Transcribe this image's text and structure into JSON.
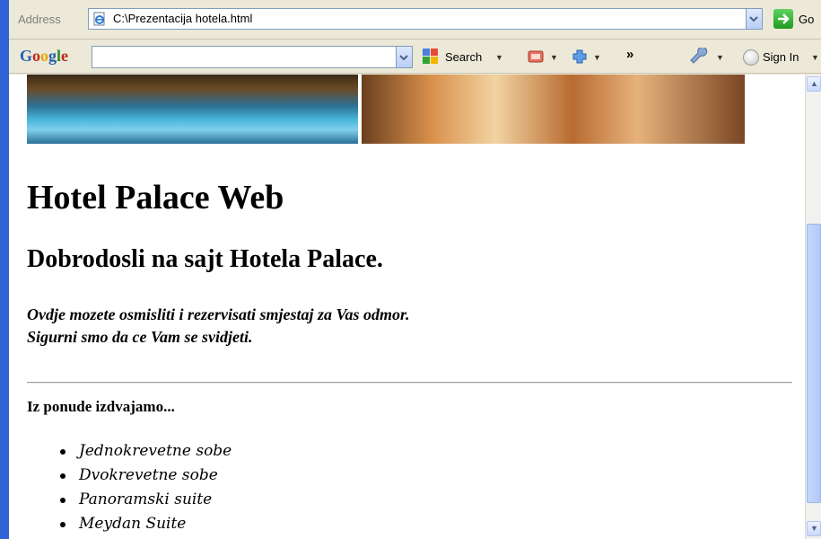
{
  "browser": {
    "address_label": "Address",
    "address_value": "C:\\Prezentacija hotela.html",
    "go_label": "Go"
  },
  "google_toolbar": {
    "logo": "Google",
    "search_query": "",
    "search_label": "Search",
    "more_label": "»",
    "sign_in_label": "Sign In"
  },
  "page": {
    "title": "Hotel Palace Web",
    "welcome": "Dobrodosli na sajt Hotela Palace.",
    "intro_line1": "Ovdje mozete osmisliti i rezervisati smjestaj za Vas odmor.",
    "intro_line2": "Sigurni smo da ce Vam se svidjeti.",
    "featured_heading": "Iz ponude izdvajamo...",
    "offers": [
      "Jednokrevetne sobe",
      "Dvokrevetne sobe",
      "Panoramski suite",
      "Meydan Suite"
    ]
  },
  "icons": {
    "page": "ie-page-icon",
    "address_dropdown": "chevron-down-icon",
    "go": "go-arrow-icon",
    "google_search": "google-search-icon",
    "popup_blocker": "popup-blocker-icon",
    "plus": "plus-icon",
    "settings": "wrench-icon",
    "sign_in": "circle-icon",
    "scroll_up": "arrow-up-icon",
    "scroll_down": "arrow-down-icon"
  },
  "colors": {
    "window_frame": "#2f63d6",
    "toolbar_bg": "#ece9d8",
    "page_bg": "#ffffff",
    "text": "#000000"
  }
}
